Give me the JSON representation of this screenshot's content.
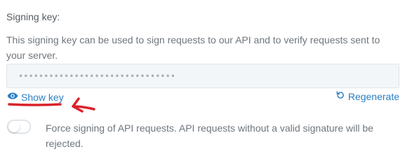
{
  "signing": {
    "label": "Signing key:",
    "description": "This signing key can be used to sign requests to our API and to verify requests sent to your server.",
    "masked_key": "•••••••••••••••••••••••••••••••",
    "show_key_label": "Show key",
    "regenerate_label": "Regenerate"
  },
  "force_signing": {
    "enabled": false,
    "text": "Force signing of API requests. API requests without a valid signature will be rejected."
  },
  "colors": {
    "link": "#2b7fc4",
    "annotation": "#d9242b"
  }
}
